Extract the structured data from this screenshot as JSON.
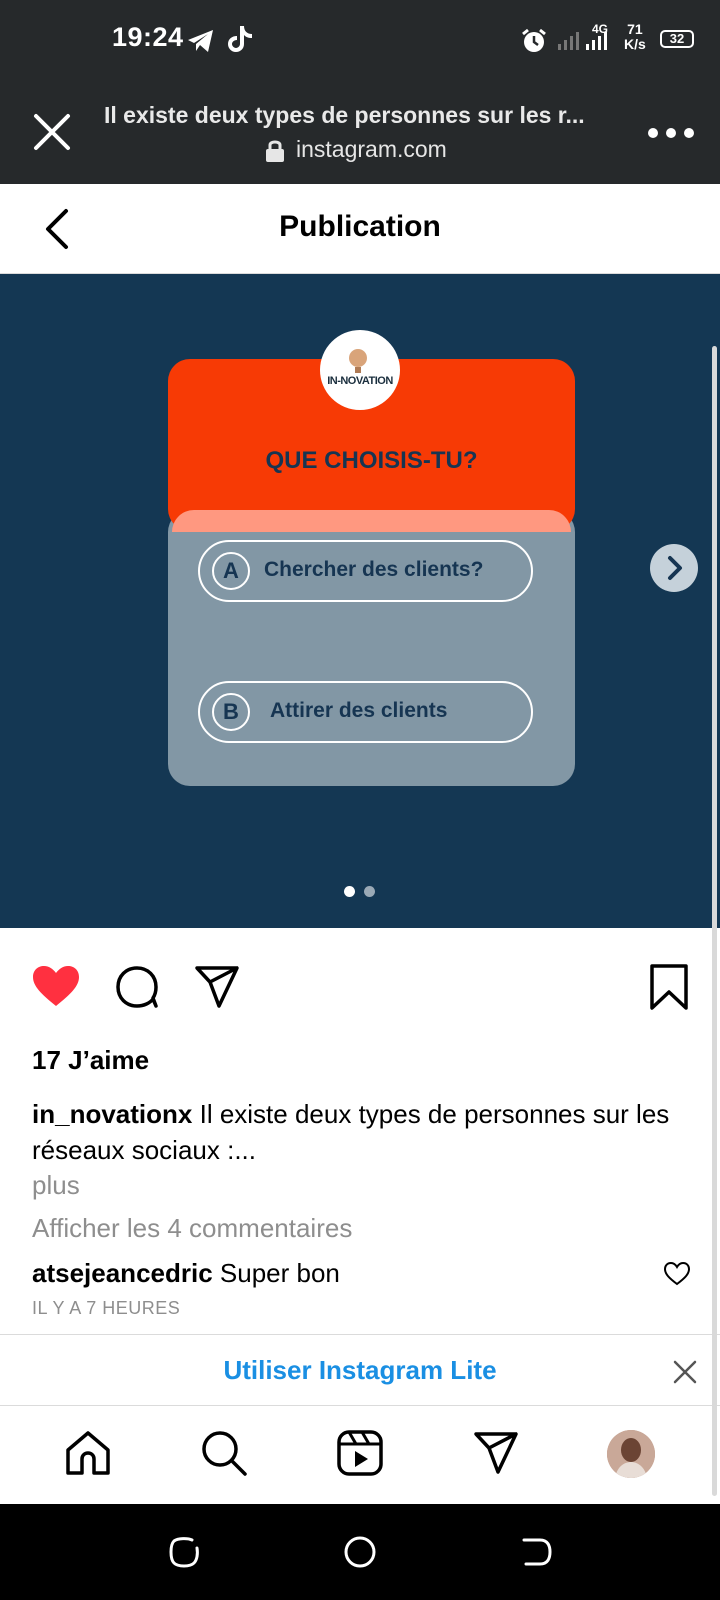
{
  "status_bar": {
    "time": "19:24",
    "network_type": "4G",
    "speed_value": "71",
    "speed_unit": "K/s",
    "battery": "32"
  },
  "browser": {
    "title": "Il existe deux types de personnes sur les r...",
    "url": "instagram.com"
  },
  "header": {
    "title": "Publication"
  },
  "post": {
    "brand_name": "IN-NOVATION",
    "question": "QUE CHOISIS-TU?",
    "options": [
      {
        "letter": "A",
        "text": "Chercher des clients?"
      },
      {
        "letter": "B",
        "text": "Attirer des clients"
      }
    ],
    "carousel": {
      "count": 2,
      "active": 1
    },
    "likes": "17 J’aime",
    "caption_user": "in_novationx",
    "caption_text": "Il existe deux types de personnes sur les réseaux sociaux :...",
    "caption_more": "plus",
    "view_comments": "Afficher les 4 commentaires",
    "comment": {
      "user": "atsejeancedric",
      "text": "Super bon",
      "time": "IL Y A 7 HEURES"
    }
  },
  "banner": {
    "link": "Utiliser Instagram Lite"
  },
  "colors": {
    "card_red": "#f73a05",
    "media_bg": "#143753",
    "link_blue": "#1a8fe3",
    "like_red": "#ff3040"
  },
  "icons": {
    "nav": [
      "home-icon",
      "search-icon",
      "reels-icon",
      "direct-icon",
      "profile-avatar"
    ],
    "actions": [
      "heart-icon",
      "comment-icon",
      "share-icon",
      "bookmark-icon"
    ]
  }
}
